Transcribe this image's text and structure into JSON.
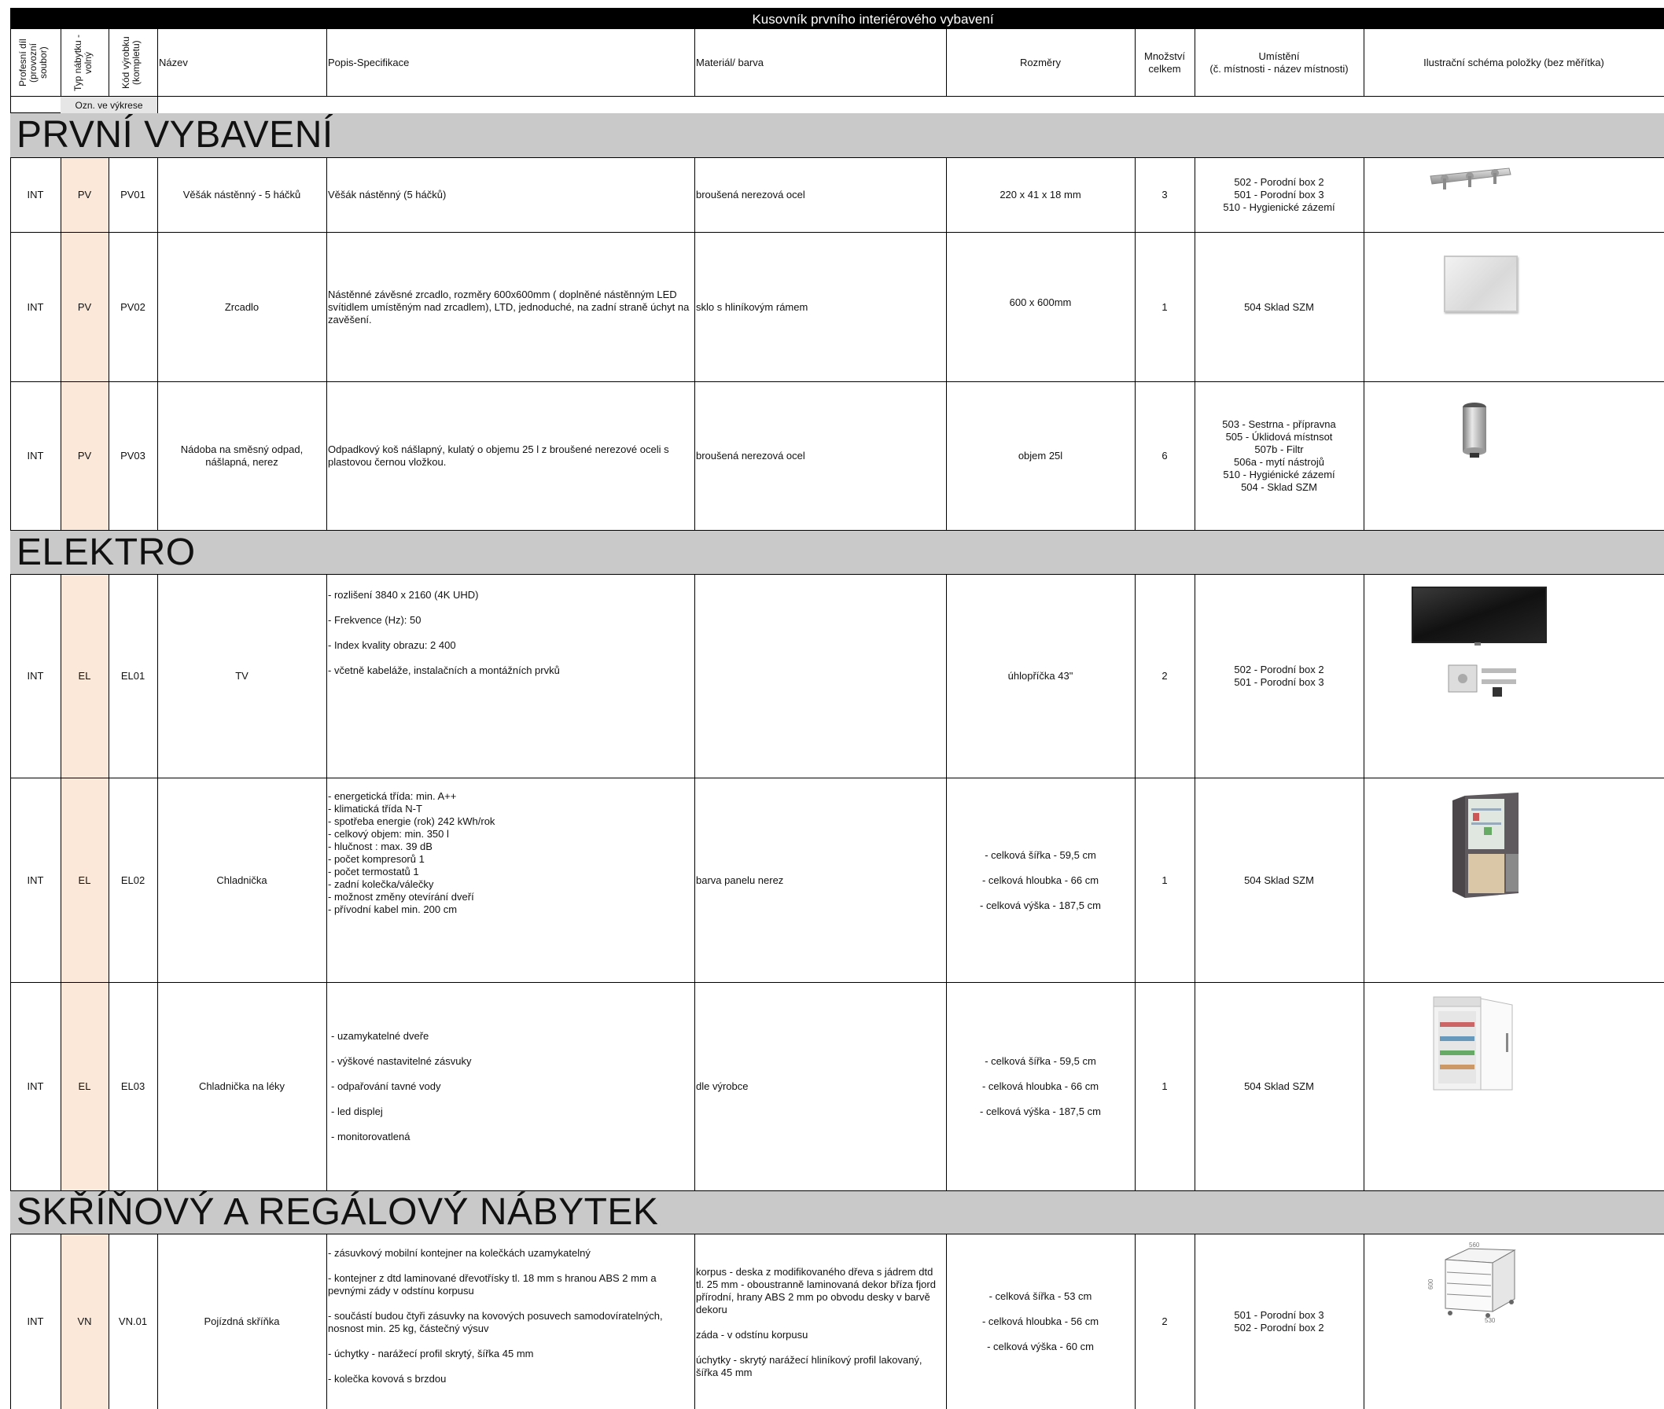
{
  "title": "Kusovník prvního interiérového vybavení",
  "headers": {
    "profesni": "Profesní díl (provozní soubor)",
    "typ": "Typ nábytku - volný",
    "kod": "Kód výrobku (kompletu)",
    "nazev": "Název",
    "popis": "Popis-Specifikace",
    "material": "Materiál/ barva",
    "rozmery": "Rozměry",
    "mnozstvi": "Množství celkem",
    "umisteni_1": "Umístění",
    "umisteni_2": "(č. místnosti - název místnosti)",
    "ilustrace": "Ilustrační schéma položky (bez měřítka)",
    "ozn": "Ozn. ve výkrese"
  },
  "sections": {
    "s1": "PRVNÍ VYBAVENÍ",
    "s2": "ELEKTRO",
    "s3": "SKŘÍŇOVÝ A REGÁLOVÝ NÁBYTEK"
  },
  "rows": [
    {
      "profesni": "INT",
      "typ": "PV",
      "kod": "PV01",
      "nazev": "Věšák nástěnný - 5 háčků",
      "popis": [
        "Věšák nástěnný (5 háčků)"
      ],
      "material": [
        "broušená nerezová ocel"
      ],
      "rozmery": [
        "220 x 41 x 18 mm"
      ],
      "mnozstvi": "3",
      "umisteni": [
        "502 - Porodní box 2",
        "501 - Porodní box 3",
        "510 - Hygienické zázemí"
      ],
      "icon": "wall-hook-rack-image"
    },
    {
      "profesni": "INT",
      "typ": "PV",
      "kod": "PV02",
      "nazev": "Zrcadlo",
      "popis": [
        "Nástěnné závěsné zrcadlo, rozměry 600x600mm  ( doplněné nástěnným LED svítidlem umístěným nad zrcadlem), LTD, jednoduché,  na zadní straně úchyt na zavěšení."
      ],
      "material": [
        "sklo s hliníkovým rámem"
      ],
      "rozmery": [
        "600 x 600mm"
      ],
      "mnozstvi": "1",
      "umisteni": [
        "504 Sklad SZM"
      ],
      "icon": "mirror-image"
    },
    {
      "profesni": "INT",
      "typ": "PV",
      "kod": "PV03",
      "nazev": "Nádoba na směsný odpad, nášlapná, nerez",
      "popis": [
        "Odpadkový koš nášlapný, kulatý o objemu 25 l z broušené nerezové oceli s plastovou černou vložkou."
      ],
      "material": [
        "broušená nerezová ocel"
      ],
      "rozmery": [
        "objem 25l"
      ],
      "mnozstvi": "6",
      "umisteni": [
        "503 - Sestrna - přípravna",
        "505 - Úklidová místnsot",
        "507b - Filtr",
        "506a - mytí nástrojů",
        "510 - Hygiénické zázemí",
        "504 - Sklad SZM"
      ],
      "icon": "pedal-bin-image"
    },
    {
      "profesni": "INT",
      "typ": "EL",
      "kod": "EL01",
      "nazev": "TV",
      "popis": [
        "- rozlišení 3840 x 2160 (4K UHD)",
        "- Frekvence (Hz): 50",
        "- Index kvality obrazu: 2 400",
        "- včetně kabeláže, instalačních a montážních prvků"
      ],
      "material": [],
      "rozmery": [
        "úhlopříčka 43\""
      ],
      "mnozstvi": "2",
      "umisteni": [
        "502 - Porodní box 2",
        "501 - Porodní box 3"
      ],
      "icon": "tv-image"
    },
    {
      "profesni": "INT",
      "typ": "EL",
      "kod": "EL02",
      "nazev": "Chladnička",
      "popis": [
        "- energetická třída: min. A++",
        "- klimatická třída N-T",
        "- spotřeba energie (rok) 242 kWh/rok",
        "- celkový objem: min. 350 l",
        "- hlučnost : max. 39 dB",
        "- počet kompresorů 1",
        "- počet termostatů 1",
        "- zadní kolečka/válečky",
        "- možnost změny otevírání dveří",
        "- přívodní kabel min. 200 cm"
      ],
      "material": [
        "barva panelu nerez"
      ],
      "rozmery": [
        "- celková šířka - 59,5 cm",
        "- celková hloubka - 66 cm",
        "- celková výška - 187,5 cm"
      ],
      "mnozstvi": "1",
      "umisteni": [
        "504 Sklad SZM"
      ],
      "icon": "fridge-image"
    },
    {
      "profesni": "INT",
      "typ": "EL",
      "kod": "EL03",
      "nazev": "Chladnička na léky",
      "popis": [
        "- uzamykatelné dveře",
        "- výškové nastavitelné zásvuky",
        "- odpařování tavné vody",
        "- led displej",
        "- monitorovatlená"
      ],
      "material": [
        "dle výrobce"
      ],
      "rozmery": [
        "- celková šířka - 59,5 cm",
        "- celková hloubka - 66 cm",
        "- celková výška - 187,5 cm"
      ],
      "mnozstvi": "1",
      "umisteni": [
        "504 Sklad SZM"
      ],
      "icon": "medical-fridge-image"
    },
    {
      "profesni": "INT",
      "typ": "VN",
      "kod": "VN.01",
      "nazev": "Pojízdná skříňka",
      "popis": [
        "- zásuvkový mobilní kontejner na kolečkách uzamykatelný",
        "- kontejner z dtd laminované dřevotřísky tl. 18 mm s hranou ABS 2 mm a pevnými zády v odstínu korpusu",
        "- součástí budou čtyři zásuvky na kovových posuvech samodovíratelných, nosnost min. 25 kg, částečný výsuv",
        "- úchytky - narážecí profil skrytý, šířka 45 mm",
        "- kolečka kovová s brzdou"
      ],
      "material": [
        "korpus - deska z modifikovaného dřeva s jádrem dtd tl. 25 mm - oboustranně laminovaná dekor bříza fjord přírodní, hrany ABS  2 mm po obvodu desky v barvě dekoru",
        "záda - v odstínu korpusu",
        "úchytky - skrytý narážecí hliníkový profil lakovaný, šířka 45 mm"
      ],
      "rozmery": [
        "- celková šířka - 53 cm",
        "- celková hloubka - 56 cm",
        "- celková výška - 60 cm"
      ],
      "mnozstvi": "2",
      "umisteni": [
        "501 - Porodní box 3",
        "502 - Porodní box 2"
      ],
      "icon": "mobile-drawer-cabinet-image",
      "dims": [
        "560",
        "600",
        "530"
      ]
    }
  ]
}
